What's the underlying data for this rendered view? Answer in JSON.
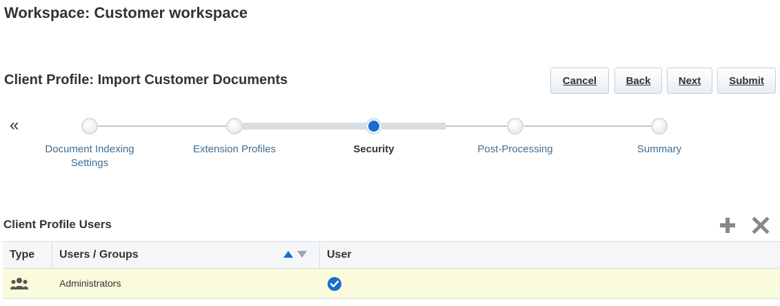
{
  "header": {
    "workspace_title": "Workspace: Customer workspace",
    "profile_title": "Client Profile: Import Customer Documents"
  },
  "toolbar": {
    "cancel_label": "Cancel",
    "back_label": "Back",
    "next_label": "Next",
    "submit_label": "Submit"
  },
  "train": {
    "collapse_glyph": "«",
    "current_index": 2,
    "steps": [
      {
        "line1": "Document Indexing",
        "line2": "Settings"
      },
      {
        "line1": "Extension Profiles",
        "line2": ""
      },
      {
        "line1": "Security",
        "line2": ""
      },
      {
        "line1": "Post-Processing",
        "line2": ""
      },
      {
        "line1": "Summary",
        "line2": ""
      }
    ]
  },
  "users_section": {
    "title": "Client Profile Users",
    "add_icon": "plus-icon",
    "remove_icon": "x-icon"
  },
  "table": {
    "headers": {
      "type": "Type",
      "users_groups": "Users / Groups",
      "user": "User"
    },
    "rows": [
      {
        "type_icon": "group-icon",
        "name": "Administrators",
        "user_checked": true
      }
    ]
  },
  "colors": {
    "accent": "#1a6ccf",
    "link": "#3e6d93",
    "selected_row": "#fafadc",
    "icon_gray": "#888888"
  }
}
